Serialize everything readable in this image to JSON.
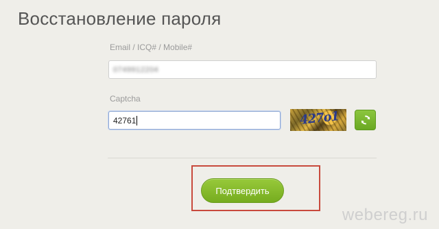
{
  "page": {
    "title": "Восстановление пароля"
  },
  "form": {
    "email_label": "Email / ICQ# / Mobile#",
    "email_value": "0749912204",
    "captcha_label": "Captcha",
    "captcha_value": "42761",
    "captcha_image_text": "427o1",
    "refresh_icon": "refresh-icon",
    "submit_label": "Подтвердить"
  },
  "watermark": {
    "text": "webereg.ru"
  },
  "colors": {
    "background": "#efeee9",
    "accent_green": "#8cc63f",
    "highlight_red": "#c8493c"
  }
}
